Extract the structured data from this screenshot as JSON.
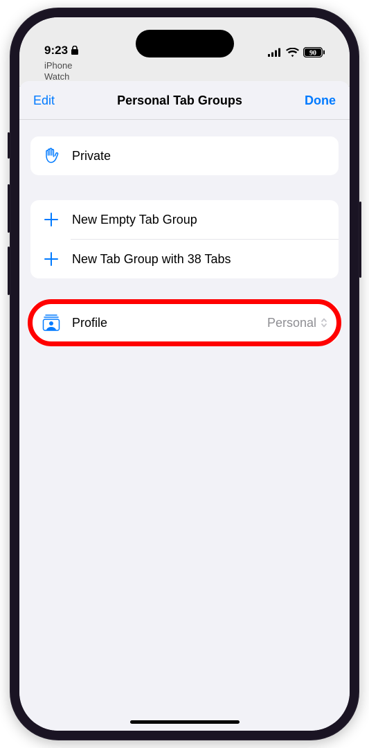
{
  "status": {
    "time": "9:23",
    "battery": "90"
  },
  "backdrop": {
    "line1": "iPhone",
    "line2": "Watch"
  },
  "sheet": {
    "edit": "Edit",
    "title": "Personal Tab Groups",
    "done": "Done"
  },
  "groups": {
    "private": "Private",
    "newEmpty": "New Empty Tab Group",
    "newWithTabs": "New Tab Group with 38 Tabs"
  },
  "profile": {
    "label": "Profile",
    "value": "Personal"
  }
}
